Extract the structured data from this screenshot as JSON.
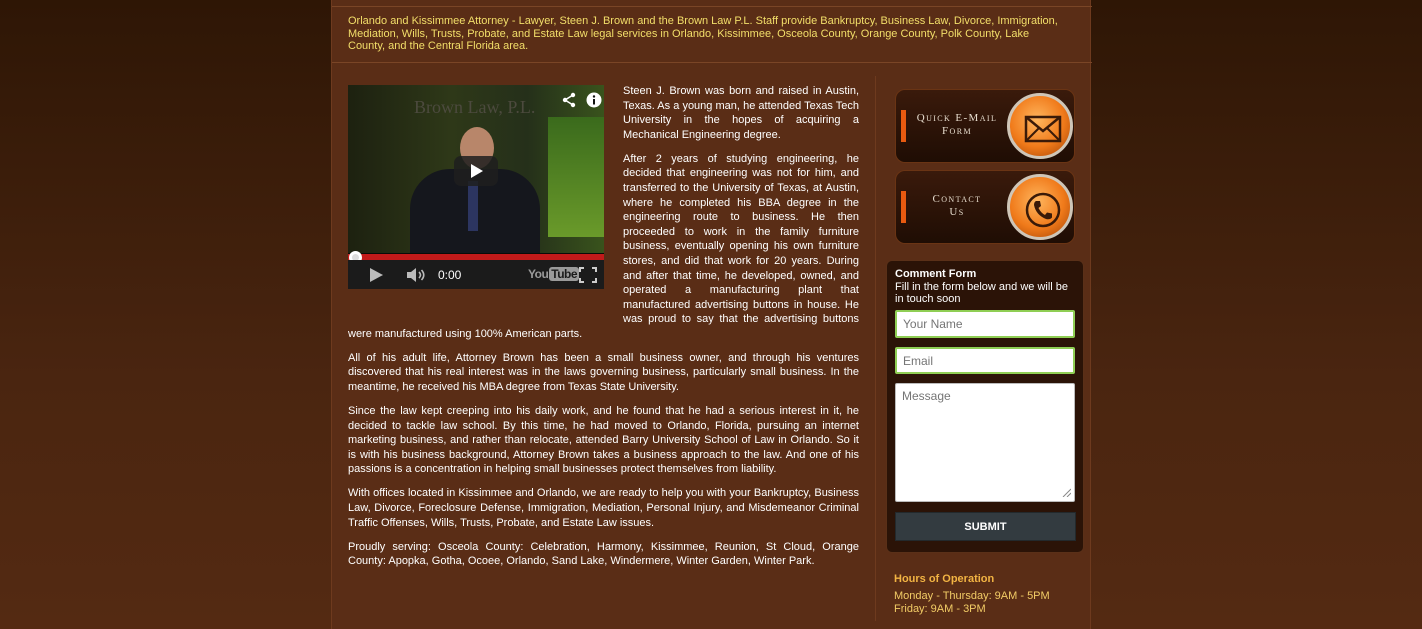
{
  "intro": {
    "text": "Orlando and Kissimmee Attorney - Lawyer, Steen J. Brown and the Brown Law P.L. Staff provide Bankruptcy, Business Law, Divorce, Immigration, Mediation, Wills, Trusts, Probate, and Estate Law legal services in Orlando, Kissimmee, Osceola County, Orange County, Polk County, Lake County, and the Central Florida area."
  },
  "video": {
    "watermark": "Brown Law, P.L.",
    "time": "0:00",
    "brand_prefix": "You",
    "brand_suffix": "Tube",
    "progress_fraction": 0.0,
    "icons": [
      "share-icon",
      "info-icon",
      "play-icon",
      "volume-icon",
      "fullscreen-icon"
    ]
  },
  "bio": {
    "paragraphs": [
      "Steen J. Brown was born and raised in Austin, Texas. As a young man, he attended Texas Tech University in the hopes of acquiring a Mechanical Engineering degree.",
      "After 2 years of studying engineering, he decided that engineering was not for him, and transferred to the University of Texas, at Austin, where he completed his BBA degree in the engineering route to business. He then proceeded to work in the family furniture business, eventually opening his own furniture stores, and did that work for 20 years. During and after that time, he developed, owned, and operated a manufacturing plant that manufactured advertising buttons in house. He was proud to say that the advertising buttons were manufactured using 100% American parts.",
      "All of his adult life, Attorney Brown has been a small business owner, and through his ventures discovered that his real interest was in the laws governing business, particularly small business. In the meantime, he received his MBA degree from Texas State University.",
      "Since the law kept creeping into his daily work, and he found that he had a serious interest in it, he decided to tackle law school. By this time, he had moved to Orlando, Florida, pursuing an internet marketing business, and rather than relocate, attended Barry University School of Law in Orlando. So it is with his business background, Attorney Brown takes a business approach to the law. And one of his passions is a concentration in helping small businesses protect themselves from liability.",
      "With offices located in Kissimmee and Orlando, we are ready to help you with your Bankruptcy, Business Law, Divorce, Foreclosure Defense, Immigration, Mediation, Personal Injury, and Misdemeanor Criminal Traffic Offenses, Wills, Trusts, Probate, and Estate Law issues.",
      "Proudly serving: Osceola County: Celebration, Harmony, Kissimmee, Reunion, St Cloud, Orange County: Apopka, Gotha, Ocoee, Orlando, Sand Lake, Windermere, Winter Garden, Winter Park."
    ]
  },
  "sidebar": {
    "email_button": {
      "line1": "Quick E-Mail",
      "line2": "Form",
      "icon": "envelope-icon"
    },
    "contact_button": {
      "line1": "Contact",
      "line2": "Us",
      "icon": "phone-icon"
    },
    "form": {
      "title": "Comment Form",
      "subtitle": "Fill in the form below and we will be in touch soon",
      "name_placeholder": "Your Name",
      "email_placeholder": "Email",
      "message_placeholder": "Message",
      "submit_label": "SUBMIT"
    },
    "hours": {
      "title": "Hours of Operation",
      "line1": "Monday - Thursday: 9AM - 5PM",
      "line2": "Friday: 9AM - 3PM"
    }
  },
  "colors": {
    "page_bg": "#5a2d16",
    "intro_text": "#f3df6a",
    "hours_title": "#f2b443",
    "accent_orange": "#f07a1a",
    "field_border": "#8fce54"
  }
}
